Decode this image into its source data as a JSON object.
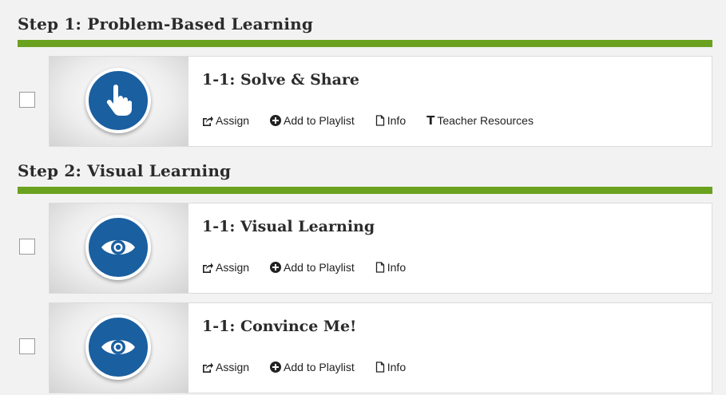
{
  "steps": [
    {
      "title": "Step 1: Problem-Based Learning",
      "items": [
        {
          "title": "1-1: Solve & Share",
          "icon": "hand-pointer-icon",
          "actions": {
            "assign": "Assign",
            "add_to_playlist": "Add to Playlist",
            "info": "Info",
            "teacher_resources": "Teacher Resources"
          }
        }
      ]
    },
    {
      "title": "Step 2: Visual Learning",
      "items": [
        {
          "title": "1-1: Visual Learning",
          "icon": "eye-icon",
          "actions": {
            "assign": "Assign",
            "add_to_playlist": "Add to Playlist",
            "info": "Info"
          }
        },
        {
          "title": "1-1: Convince Me!",
          "icon": "eye-icon",
          "actions": {
            "assign": "Assign",
            "add_to_playlist": "Add to Playlist",
            "info": "Info"
          }
        }
      ]
    }
  ],
  "colors": {
    "accent_bar": "#6aa21f",
    "icon_circle": "#1a5fa0",
    "page_background": "#f2f2f2"
  }
}
